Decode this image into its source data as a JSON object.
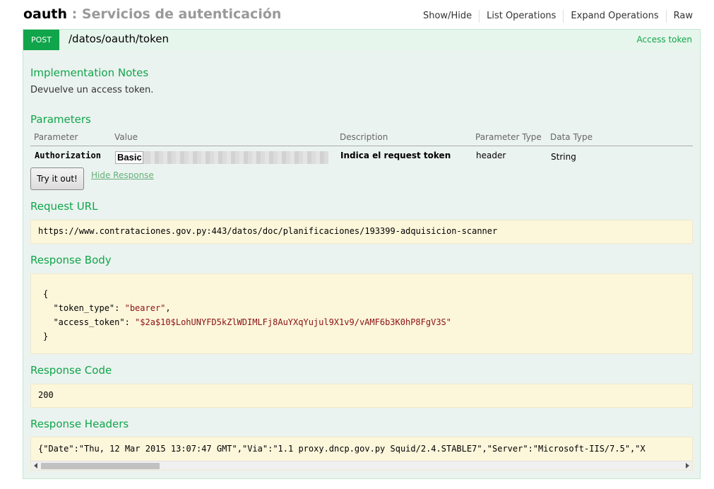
{
  "heading": {
    "resource": "oauth",
    "separator": " : ",
    "description": "Servicios de autenticación",
    "ops": [
      "Show/Hide",
      "List Operations",
      "Expand Operations",
      "Raw"
    ]
  },
  "operation": {
    "method": "POST",
    "path": "/datos/oauth/token",
    "summary": "Access token",
    "implementation_notes_title": "Implementation Notes",
    "implementation_notes": "Devuelve un access token.",
    "parameters_title": "Parameters",
    "param_headers": [
      "Parameter",
      "Value",
      "Description",
      "Parameter Type",
      "Data Type"
    ],
    "param": {
      "name": "Authorization",
      "value": "Basic",
      "description": "Indica el request token",
      "param_type": "header",
      "data_type": "String"
    },
    "try_button": "Try it out!",
    "hide_response": "Hide Response",
    "request_url_title": "Request URL",
    "request_url": "https://www.contrataciones.gov.py:443/datos/doc/planificaciones/193399-adquisicion-scanner",
    "response_body_title": "Response Body",
    "response_body": {
      "open": "{",
      "token_type_key": "\"token_type\"",
      "token_type_value": "\"bearer\"",
      "access_token_key": "\"access_token\"",
      "access_token_value": "\"$2a$10$LohUNYFD5kZlWDIMLFj8AuYXqYujul9X1v9/vAMF6b3K0hP8FgV3S\"",
      "close": "}"
    },
    "response_code_title": "Response Code",
    "response_code": "200",
    "response_headers_title": "Response Headers",
    "response_headers": "{\"Date\":\"Thu, 12 Mar 2015 13:07:47 GMT\",\"Via\":\"1.1 proxy.dncp.gov.py Squid/2.4.STABLE7\",\"Server\":\"Microsoft-IIS/7.5\",\"X"
  },
  "colors": {
    "accent": "#10a54a",
    "block_bg": "#fcf6db",
    "op_bg": "#ebf3f0"
  }
}
